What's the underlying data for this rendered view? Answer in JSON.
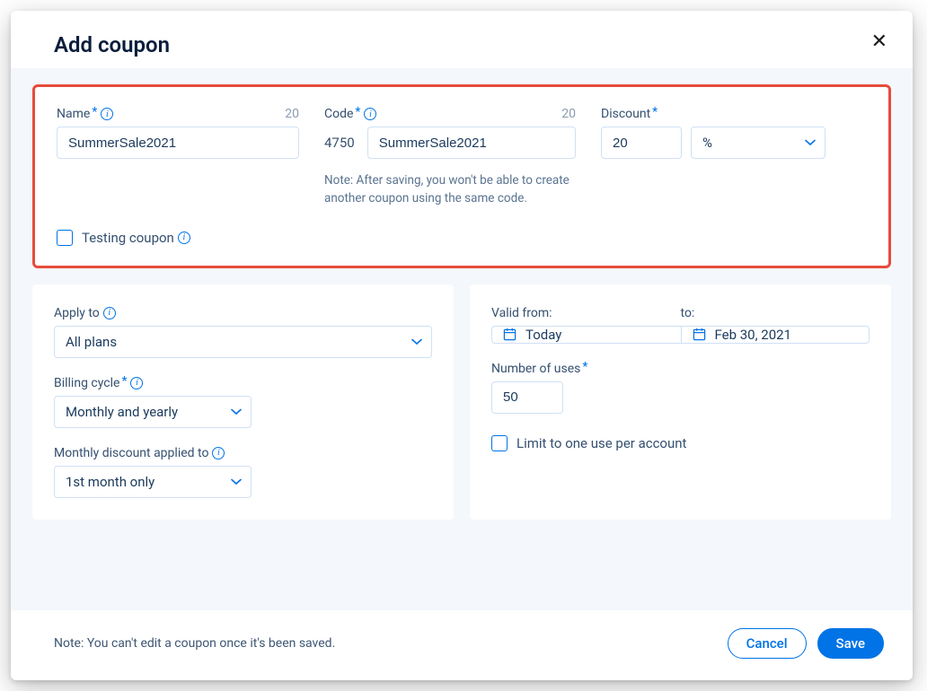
{
  "header": {
    "title": "Add coupon"
  },
  "main": {
    "name": {
      "label": "Name",
      "counter": "20",
      "value": "SummerSale2021"
    },
    "code": {
      "label": "Code",
      "counter": "20",
      "prefix": "4750",
      "value": "SummerSale2021",
      "note": "Note: After saving, you won't be able to create another coupon using the same code."
    },
    "discount": {
      "label": "Discount",
      "value": "20",
      "unit": "%"
    },
    "testing": {
      "label": "Testing coupon"
    }
  },
  "left": {
    "apply_to": {
      "label": "Apply to",
      "value": "All plans"
    },
    "billing_cycle": {
      "label": "Billing cycle",
      "value": "Monthly and yearly"
    },
    "monthly_discount": {
      "label": "Monthly discount applied to",
      "value": "1st month only"
    }
  },
  "right": {
    "valid_from": {
      "label": "Valid from:",
      "value": "Today"
    },
    "valid_to": {
      "label": "to:",
      "value": "Feb 30, 2021"
    },
    "uses": {
      "label": "Number of uses",
      "value": "50"
    },
    "limit": {
      "label": "Limit to one use per account"
    }
  },
  "footer": {
    "note": "Note: You can't edit a coupon once it's been saved.",
    "cancel": "Cancel",
    "save": "Save"
  }
}
